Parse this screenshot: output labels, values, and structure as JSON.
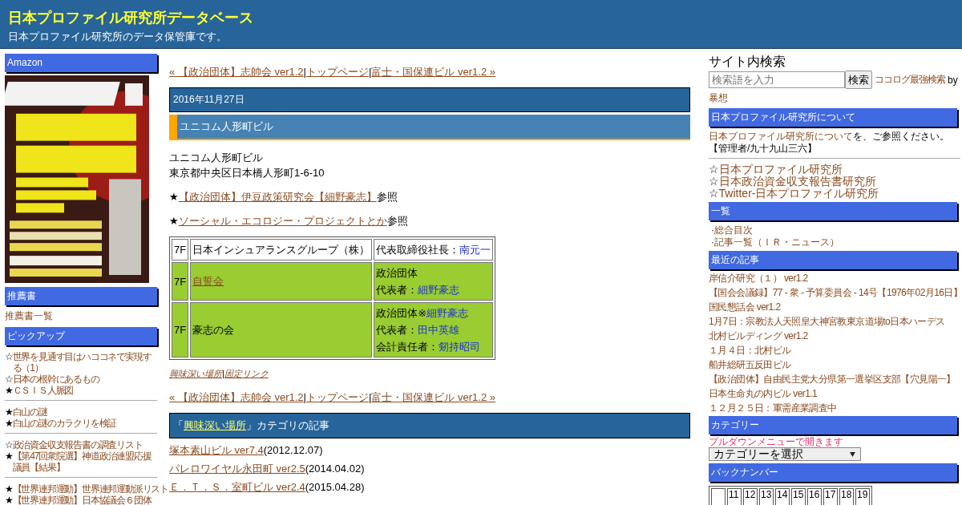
{
  "header": {
    "title": "日本プロファイル研究所データベース",
    "subtitle": "日本プロファイル研究所のデータ保管庫です。"
  },
  "left": {
    "amazon": {
      "heading": "Amazon"
    },
    "recommend": {
      "heading": "推薦書",
      "link": "推薦書一覧"
    },
    "pickup": {
      "heading": "ピックアップ",
      "groups": [
        [
          {
            "star": "☆",
            "link": "世界を見通す目はハココネで実現する（1）"
          },
          {
            "star": "☆",
            "link": "日本の根幹にあるもの"
          },
          {
            "star": "★",
            "link": "ＣＳＩＳ人脈図"
          }
        ],
        [
          {
            "star": "★",
            "link": "白山の謎"
          },
          {
            "star": "★",
            "link": "白山の謎のカラクリを検証"
          }
        ],
        [
          {
            "star": "☆",
            "link": "政治資金収支報告書の調査リスト"
          },
          {
            "star": "★",
            "link": "【第47回衆院選】神道政治連盟応援議員【結果】"
          }
        ],
        [
          {
            "star": "★",
            "link": "【世界連邦運動】世界連邦運動派リスト"
          },
          {
            "star": "★",
            "link": "【世界連邦運動】日本協議会６団体"
          }
        ]
      ]
    }
  },
  "main": {
    "nav_top": {
      "prev": "« 【政治団体】志帥会 ver1.2",
      "top": "トップページ",
      "next": "富士・国保連ビル ver1.2 »",
      "separator": "|"
    },
    "date": "2016年11月27日",
    "title": "ユニコム人形町ビル",
    "lines": [
      "ユニコム人形町ビル",
      "東京都中央区日本橋人形町1-6-10"
    ],
    "refs": [
      {
        "star": "★",
        "link": "【政治団体】伊豆政策研究会【細野豪志】",
        "suffix": "参照"
      },
      {
        "star": "★",
        "link": "ソーシャル・エコロジー・プロジェクトとか",
        "suffix": "参照"
      }
    ],
    "table": {
      "rows": [
        {
          "floor": "7F",
          "highlighted": false,
          "name": {
            "text": "日本インシュアランスグループ（株）",
            "kind": "plain"
          },
          "info": [
            [
              {
                "text": "代表取締役社長：",
                "kind": "plain"
              },
              {
                "text": "南元一",
                "kind": "person"
              }
            ]
          ]
        },
        {
          "floor": "7F",
          "highlighted": true,
          "name": {
            "text": "自誓会",
            "kind": "link"
          },
          "info": [
            [
              {
                "text": "政治団体",
                "kind": "plain"
              }
            ],
            [
              {
                "text": "代表者：",
                "kind": "plain"
              },
              {
                "text": "細野豪志",
                "kind": "person"
              }
            ]
          ]
        },
        {
          "floor": "7F",
          "highlighted": true,
          "name": {
            "text": "豪志の会",
            "kind": "plain"
          },
          "info": [
            [
              {
                "text": "政治団体※",
                "kind": "plain"
              },
              {
                "text": "細野豪志",
                "kind": "person"
              }
            ],
            [
              {
                "text": "代表者：",
                "kind": "plain"
              },
              {
                "text": "田中英雄",
                "kind": "person"
              }
            ],
            [
              {
                "text": "会計責任者：",
                "kind": "plain"
              },
              {
                "text": "剱持昭司",
                "kind": "person"
              }
            ]
          ]
        }
      ]
    },
    "footer_links": {
      "category": "興味深い場所",
      "separator": "|",
      "permalink": "固定リンク"
    },
    "nav_bottom": {
      "prev": "« 【政治団体】志帥会 ver1.2",
      "top": "トップページ",
      "next": "富士・国保連ビル ver1.2 »",
      "separator": "|"
    },
    "category": {
      "prefix": "「",
      "link": "興味深い場所",
      "suffix": "」カテゴリの記事"
    },
    "articles": [
      {
        "title": "塚本素山ビル ver7.4",
        "date": "(2012.12.07)"
      },
      {
        "title": "パレロワイヤル永田町 ver2.5",
        "date": "(2014.04.02)"
      },
      {
        "title": "Ｅ．Ｔ．Ｓ．室町ビル ver2.4",
        "date": "(2015.04.28)"
      }
    ]
  },
  "right": {
    "search": {
      "heading": "サイト内検索",
      "placeholder": "検索語を入力",
      "button": "検索",
      "credit": "ココログ最強検索",
      "by": "by",
      "author": "暴想"
    },
    "about": {
      "heading": "日本プロファイル研究所について",
      "link": "日本プロファイル研究所について",
      "suffix": "を、ご参照ください。",
      "admin": "【管理者/九十九山三六】"
    },
    "sites": [
      {
        "star": "☆",
        "link": "日本プロファイル研究所"
      },
      {
        "star": "☆",
        "link": "日本政治資金収支報告書研究所"
      },
      {
        "star": "☆",
        "link": "Twitter-日本プロファイル研究所"
      }
    ],
    "index": {
      "heading": "一覧",
      "bullet": "·",
      "items": [
        "総合目次",
        "記事一覧（ＩＲ・ニュース）"
      ]
    },
    "recent": {
      "heading": "最近の記事",
      "items": [
        "岸信介研究（１） ver1.2",
        "【国会会議録】77 - 衆 - 予算委員会 - 14号【1976年02月16日】",
        "国民懇話会 ver1.2",
        "1月7日：宗教法人天照皇大神宮教東京道場to日本ハーデス",
        "北村ビルディング ver1.2",
        "１月４日：北村ビル",
        "船井総研五反田ビル",
        "【政治団体】自由民主党大分県第一選挙区支部【穴見陽一】",
        "日本生命丸の内ビル ver1.1",
        "１２月２５日：軍需産業調査中"
      ]
    },
    "categories": {
      "heading": "カテゴリー",
      "note": "プルダウンメニューで開きます",
      "select": "カテゴリーを選択"
    },
    "backnumber": {
      "heading": "バックナンバー",
      "days": [
        "11",
        "12",
        "13",
        "14",
        "15",
        "16",
        "17",
        "18",
        "19"
      ]
    }
  }
}
